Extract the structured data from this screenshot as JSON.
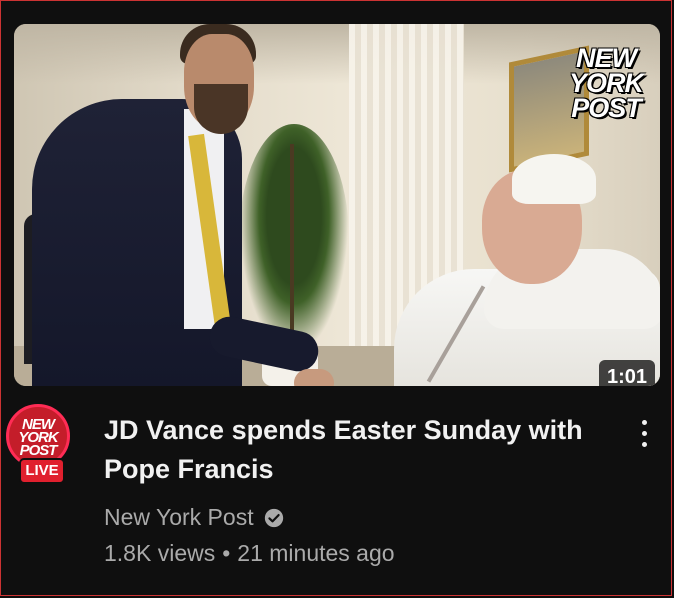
{
  "video": {
    "duration": "1:01",
    "title_line1": "JD Vance spends Easter Sunday with",
    "title_line2": "Pope Francis",
    "thumbnail_logo": [
      "NEW",
      "YORK",
      "POST"
    ]
  },
  "channel": {
    "name": "New York Post",
    "avatar_logo": [
      "NEW",
      "YORK",
      "POST"
    ],
    "live_label": "LIVE",
    "verified_icon": "verified-check-icon"
  },
  "meta": {
    "views": "1.8K views",
    "separator": "•",
    "age": "21 minutes ago"
  },
  "icons": {
    "menu": "kebab-menu-icon"
  },
  "colors": {
    "background": "#0f0f0f",
    "title": "#f1f1f1",
    "secondary": "#aaaaaa",
    "live_red": "#e0202e",
    "ring": "#ff2c55"
  }
}
